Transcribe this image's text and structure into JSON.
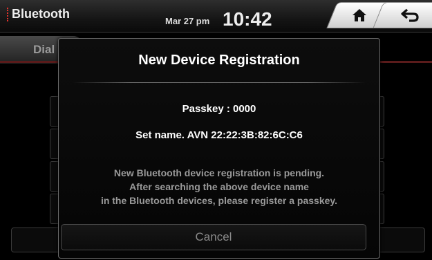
{
  "header": {
    "app_title": "Bluetooth",
    "date": "Mar 27 pm",
    "time": "10:42",
    "home_icon": "home-icon",
    "back_icon": "back-arrow-icon"
  },
  "background": {
    "tab_label": "Dial"
  },
  "dialog": {
    "title": "New Device Registration",
    "passkey": "Passkey : 0000",
    "set_name": "Set name. AVN 22:22:3B:82:6C:C6",
    "message_lines": [
      "New Bluetooth device registration is pending.",
      "After searching the above device name",
      "in the Bluetooth devices, please register a passkey."
    ],
    "cancel_label": "Cancel"
  },
  "colors": {
    "accent": "#e0332c",
    "background": "#000000",
    "text": "#ffffff",
    "muted_text": "#9a9a9a"
  }
}
